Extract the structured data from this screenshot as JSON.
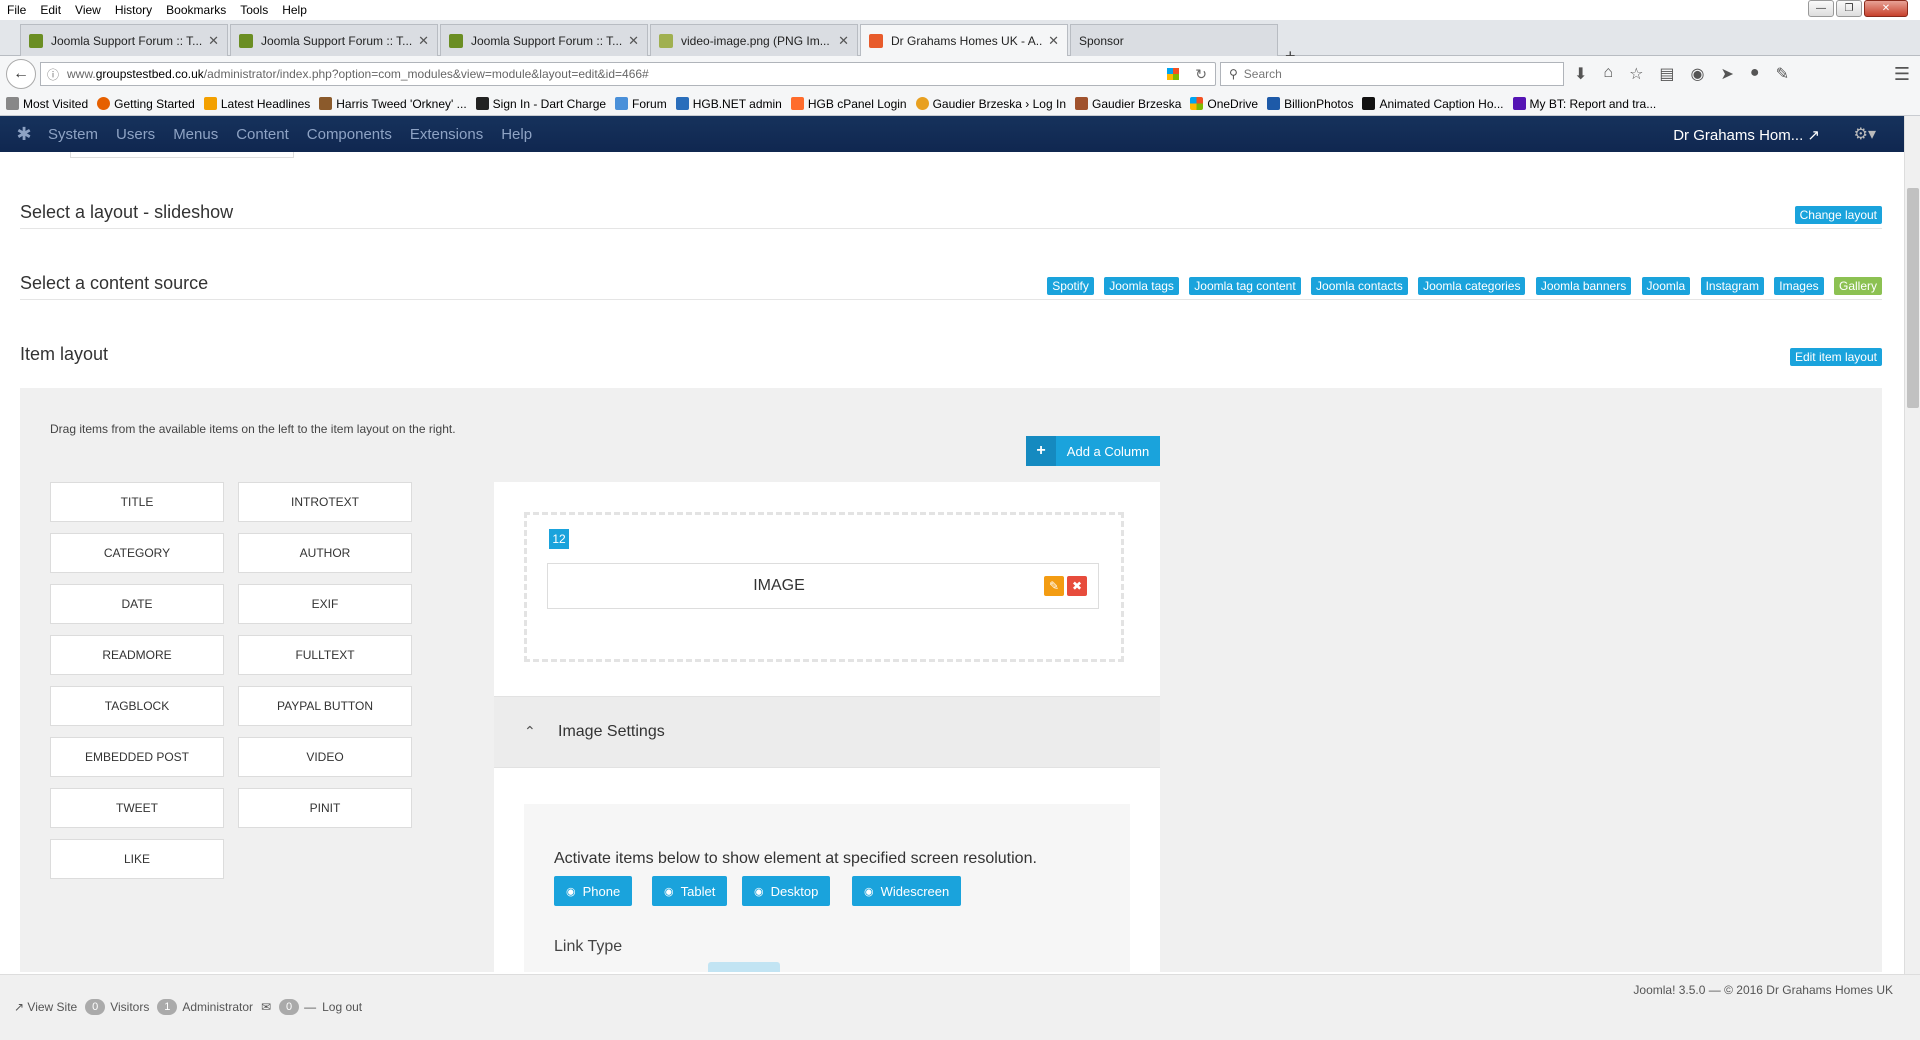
{
  "browser": {
    "menu": [
      "File",
      "Edit",
      "View",
      "History",
      "Bookmarks",
      "Tools",
      "Help"
    ],
    "tabs": [
      {
        "label": "Joomla Support Forum :: T...",
        "color": "#6b8e23"
      },
      {
        "label": "Joomla Support Forum :: T...",
        "color": "#6b8e23"
      },
      {
        "label": "Joomla Support Forum :: T...",
        "color": "#6b8e23"
      },
      {
        "label": "video-image.png (PNG Im...",
        "color": "#a0b050"
      },
      {
        "label": "Dr Grahams Homes UK - A...",
        "color": "#e85b2b"
      },
      {
        "label": "Sponsor",
        "color": ""
      }
    ],
    "url": {
      "prefix": "www.",
      "domain": "groupstestbed.co.uk",
      "path": "/administrator/index.php?option=com_modules&view=module&layout=edit&id=466#"
    },
    "search_placeholder": "Search",
    "bookmarks": [
      {
        "label": "Most Visited",
        "color": "#888"
      },
      {
        "label": "Getting Started",
        "color": "#e66000"
      },
      {
        "label": "Latest Headlines",
        "color": "#f3a000"
      },
      {
        "label": "Harris Tweed 'Orkney' ...",
        "color": "#8b5a2b"
      },
      {
        "label": "Sign In - Dart Charge",
        "color": "#222"
      },
      {
        "label": "Forum",
        "color": "#4a90d9"
      },
      {
        "label": "HGB.NET admin",
        "color": "#2a6ebb"
      },
      {
        "label": "HGB cPanel Login",
        "color": "#ff6c2c"
      },
      {
        "label": "Gaudier Brzeska › Log In",
        "color": "#e8a020"
      },
      {
        "label": "Gaudier Brzeska",
        "color": "#a0522d"
      },
      {
        "label": "OneDrive",
        "color": "#f25022"
      },
      {
        "label": "BillionPhotos",
        "color": "#1e5aa8"
      },
      {
        "label": "Animated Caption Ho...",
        "color": "#111"
      },
      {
        "label": "My BT: Report and tra...",
        "color": "#5514b4"
      }
    ]
  },
  "joomla": {
    "menu": [
      "System",
      "Users",
      "Menus",
      "Content",
      "Components",
      "Extensions",
      "Help"
    ],
    "site_name": "Dr Grahams Hom...",
    "layout_title": "Select a layout - slideshow",
    "change_layout": "Change layout",
    "content_source_title": "Select a content source",
    "sources": [
      "Spotify",
      "Joomla tags",
      "Joomla tag content",
      "Joomla contacts",
      "Joomla categories",
      "Joomla banners",
      "Joomla",
      "Instagram",
      "Images",
      "Gallery"
    ],
    "item_layout_title": "Item layout",
    "edit_item_layout": "Edit item layout",
    "drag_hint": "Drag items from the available items on the left to the item layout on the right.",
    "add_column": "Add a Column",
    "available_items": [
      "TITLE",
      "INTROTEXT",
      "CATEGORY",
      "AUTHOR",
      "DATE",
      "EXIF",
      "READMORE",
      "FULLTEXT",
      "TAGBLOCK",
      "PAYPAL BUTTON",
      "EMBEDDED POST",
      "VIDEO",
      "TWEET",
      "PINIT",
      "LIKE"
    ],
    "column_width": "12",
    "placed_item": "IMAGE",
    "image_settings": "Image Settings",
    "activate_text": "Activate items below to show element at specified screen resolution.",
    "devices": [
      "Phone",
      "Tablet",
      "Desktop",
      "Widescreen"
    ],
    "link_type": "Link Type"
  },
  "status": {
    "view_site": "View Site",
    "visitors_count": "0",
    "visitors": "Visitors",
    "admin_count": "1",
    "administrator": "Administrator",
    "messages_count": "0",
    "logout": "Log out",
    "version": "Joomla! 3.5.0  —  © 2016 Dr Grahams Homes UK"
  }
}
